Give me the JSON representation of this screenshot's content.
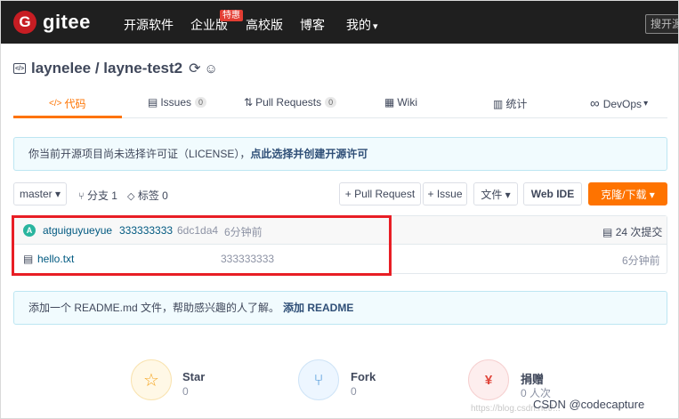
{
  "nav": {
    "logo_mark": "G",
    "logo_text": "gitee",
    "items": [
      "开源软件",
      "企业版",
      "高校版",
      "博客",
      "我的"
    ],
    "enterprise_badge": "特惠",
    "my_caret": "▾",
    "search_placeholder": "搜开源"
  },
  "repo": {
    "icon_text": "</>",
    "title": "laynelee / layne-test2",
    "sync_icon": "⟳",
    "award_icon": "☺"
  },
  "tabs": {
    "code": {
      "icon": "</>",
      "label": "代码"
    },
    "issues": {
      "icon": "▤",
      "label": "Issues",
      "count": "0"
    },
    "pulls": {
      "icon": "⇅",
      "label": "Pull Requests",
      "count": "0"
    },
    "wiki": {
      "icon": "▦",
      "label": "Wiki"
    },
    "stats": {
      "icon": "▥",
      "label": "统计"
    },
    "devops": {
      "icon": "∞",
      "label": "DevOps",
      "caret": "▾"
    }
  },
  "license_notice": {
    "text": "你当前开源项目尚未选择许可证（LICENSE），",
    "link": "点此选择并创建开源许可"
  },
  "toolbar": {
    "branch": "master ▾",
    "branches": "分支 1",
    "tags": "标签 0",
    "pull_request": "+ Pull Request",
    "issue": "+ Issue",
    "file": "文件 ▾",
    "webide": "Web IDE",
    "clone": "克隆/下载 ▾"
  },
  "commit": {
    "avatar_letter": "A",
    "author": "atguiguyueyue",
    "message": "333333333",
    "hash": "6dc1da4",
    "time": "6分钟前",
    "total": "24 次提交"
  },
  "files": [
    {
      "name": "hello.txt",
      "message": "333333333",
      "time": "6分钟前"
    }
  ],
  "readme_notice": {
    "text": "添加一个 README.md 文件，帮助感兴趣的人了解。",
    "link": "添加 README"
  },
  "stats": {
    "star": {
      "label": "Star",
      "count": "0"
    },
    "fork": {
      "label": "Fork",
      "count": "0"
    },
    "donate": {
      "label": "捐赠",
      "count": "0 人次"
    }
  },
  "watermark": "CSDN @codecapture",
  "watermark_faint": "https://blog.csdn.net/..."
}
